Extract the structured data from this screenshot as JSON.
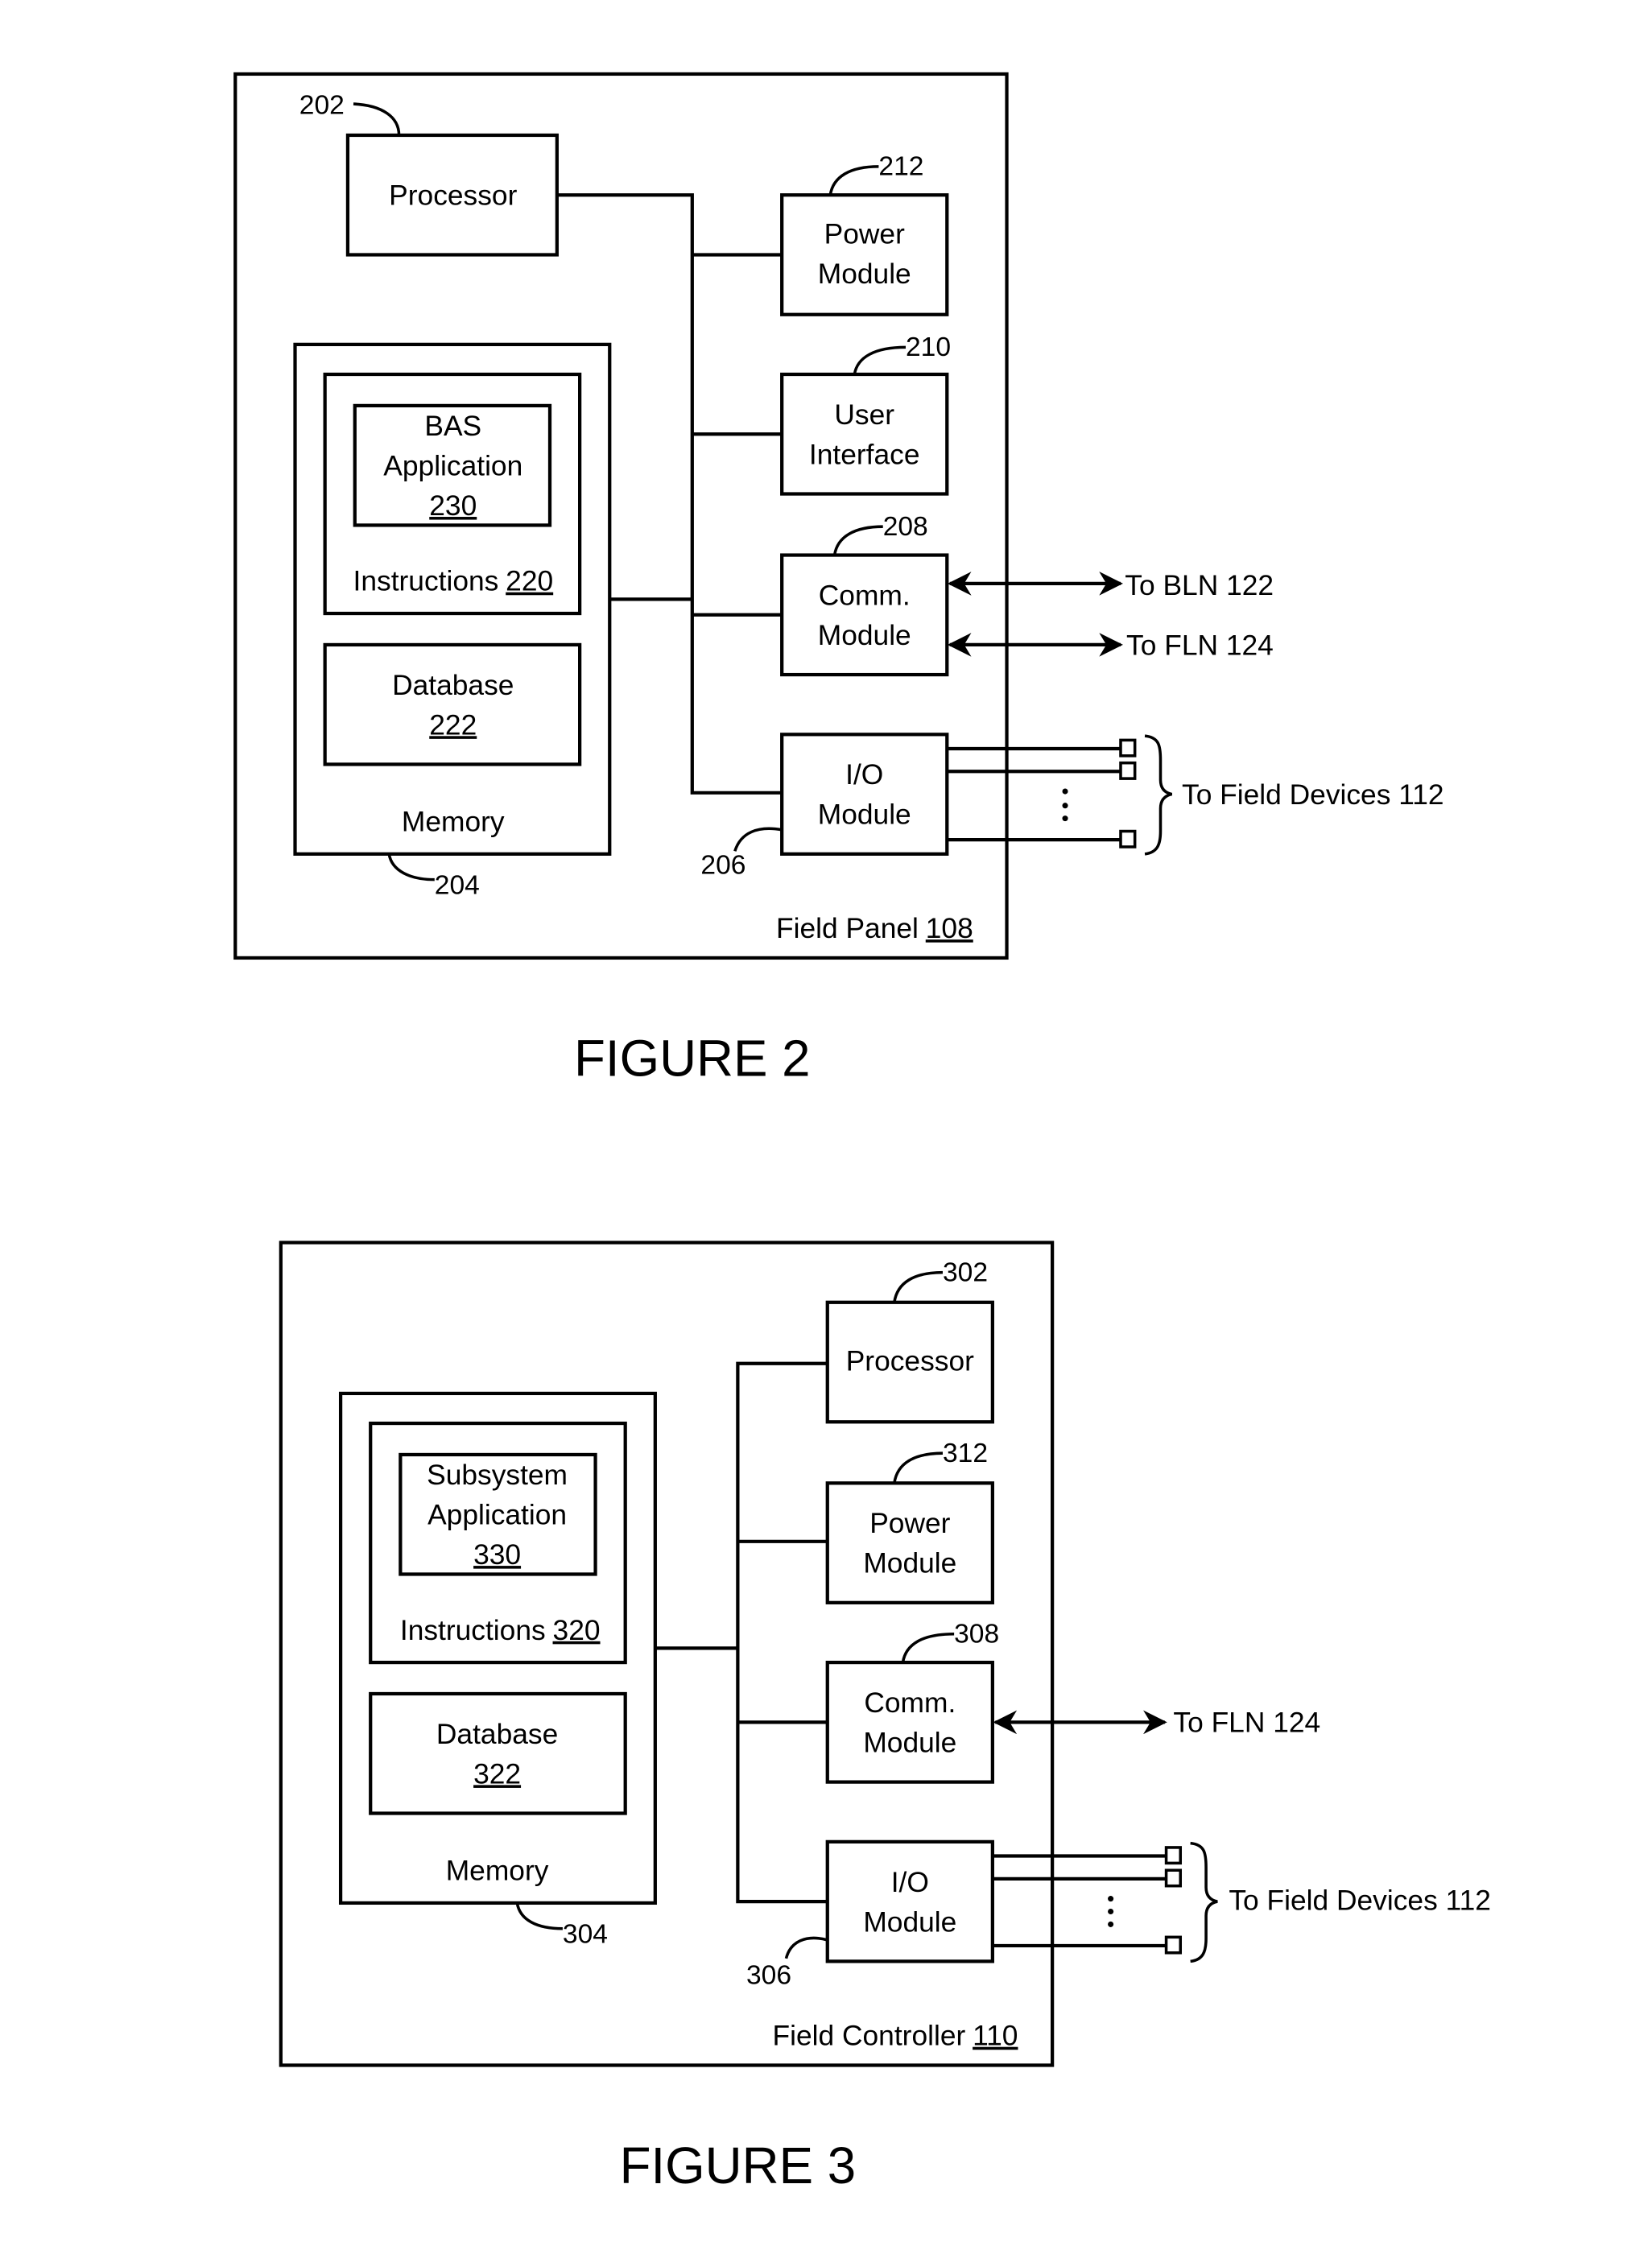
{
  "figures": [
    {
      "id": "fig2",
      "caption": "FIGURE 2",
      "container": {
        "label": "Field Panel",
        "ref": "108"
      },
      "processor": {
        "label": "Processor",
        "ref": "202"
      },
      "memory": {
        "label": "Memory",
        "ref": "204"
      },
      "instructions": {
        "label": "Instructions",
        "ref": "220"
      },
      "application": {
        "line1": "BAS",
        "line2": "Application",
        "ref": "230"
      },
      "database": {
        "label": "Database",
        "ref": "222"
      },
      "power": {
        "line1": "Power",
        "line2": "Module",
        "ref": "212"
      },
      "ui": {
        "line1": "User",
        "line2": "Interface",
        "ref": "210"
      },
      "comm": {
        "line1": "Comm.",
        "line2": "Module",
        "ref": "208",
        "links": [
          "To BLN 122",
          "To FLN 124"
        ]
      },
      "io": {
        "line1": "I/O",
        "line2": "Module",
        "ref": "206",
        "target": "To Field Devices 112"
      }
    },
    {
      "id": "fig3",
      "caption": "FIGURE 3",
      "container": {
        "label": "Field Controller",
        "ref": "110"
      },
      "processor": {
        "label": "Processor",
        "ref": "302"
      },
      "memory": {
        "label": "Memory",
        "ref": "304"
      },
      "instructions": {
        "label": "Instructions",
        "ref": "320"
      },
      "application": {
        "line1": "Subsystem",
        "line2": "Application",
        "ref": "330"
      },
      "database": {
        "label": "Database",
        "ref": "322"
      },
      "power": {
        "line1": "Power",
        "line2": "Module",
        "ref": "312"
      },
      "comm": {
        "line1": "Comm.",
        "line2": "Module",
        "ref": "308",
        "links": [
          "To FLN 124"
        ]
      },
      "io": {
        "line1": "I/O",
        "line2": "Module",
        "ref": "306",
        "target": "To Field Devices 112"
      }
    }
  ]
}
